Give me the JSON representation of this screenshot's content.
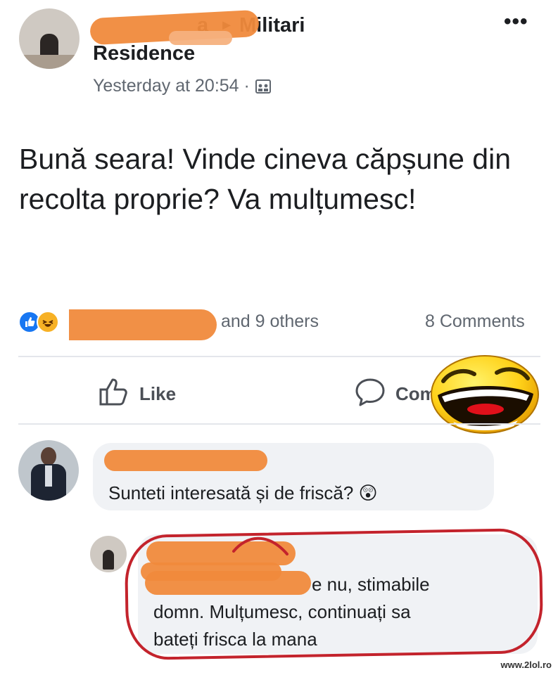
{
  "post": {
    "author_suffix": "a",
    "group_arrow": "►",
    "group_name": "Militari Residence",
    "time": "Yesterday at 20:54 ·",
    "privacy_icon": "group-icon",
    "more_label": "•••",
    "text": "Bună seara! Vinde cineva căpșune din recolta proprie? Va mulțumesc!"
  },
  "reactions": {
    "icons": [
      "like-icon",
      "haha-icon"
    ],
    "others_label": "and 9 others",
    "comments_label": "8 Comments"
  },
  "actions": {
    "like_label": "Like",
    "comment_label": "Com"
  },
  "comment": {
    "text": "Sunteti interesată și de friscă?",
    "emoji": "😲"
  },
  "reply": {
    "text_line1": "e nu, stimabile",
    "text_line2": "domn. Mulțumesc, continuați sa",
    "text_line3": "bateți frisca la mana"
  },
  "watermark": "www.2lol.ro",
  "colors": {
    "scribble": "#f08a3c",
    "circle": "#c3232c",
    "like_blue": "#1877f2"
  }
}
